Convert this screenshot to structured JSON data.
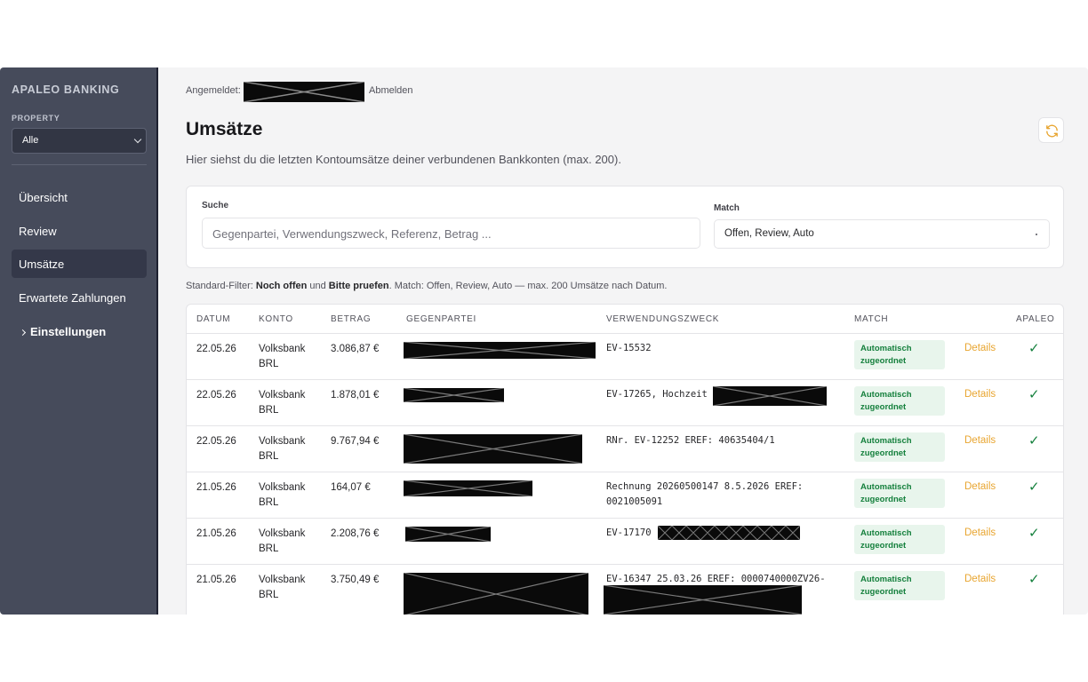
{
  "sidebar": {
    "brand": "APALEO BANKING",
    "property_label": "PROPERTY",
    "property_value": "Alle",
    "items": [
      {
        "label": "Übersicht"
      },
      {
        "label": "Review"
      },
      {
        "label": "Umsätze"
      },
      {
        "label": "Erwartete Zahlungen"
      },
      {
        "label": "Einstellungen"
      }
    ]
  },
  "header": {
    "logged_in_label": "Angemeldet:",
    "logout_label": "Abmelden",
    "title": "Umsätze",
    "subtitle": "Hier siehst du die letzten Kontoumsätze deiner verbundenen Bankkonten (max. 200)."
  },
  "filters": {
    "search_label": "Suche",
    "search_placeholder": "Gegenpartei, Verwendungszweck, Referenz, Betrag ...",
    "match_label": "Match",
    "match_value": "Offen, Review, Auto"
  },
  "standard_filter": {
    "prefix": "Standard-Filter: ",
    "open": "Noch offen",
    "and": " und ",
    "review": "Bitte pruefen",
    "suffix": ". Match: Offen, Review, Auto — max. 200 Umsätze nach Datum."
  },
  "table": {
    "headers": [
      "DATUM",
      "KONTO",
      "BETRAG",
      "GEGENPARTEI",
      "VERWENDUNGSZWECK",
      "MATCH",
      "APALEO"
    ],
    "rows": [
      {
        "datum": "22.05.26",
        "konto": "Volksbank BRL",
        "betrag": "3.086,87 €",
        "zweck": "EV-15532",
        "match": "Automatisch zugeordnet",
        "action": "Details",
        "apaleo": "✓"
      },
      {
        "datum": "22.05.26",
        "konto": "Volksbank BRL",
        "betrag": "1.878,01 €",
        "zweck": "EV-17265, Hochzeit",
        "match": "Automatisch zugeordnet",
        "action": "Details",
        "apaleo": "✓"
      },
      {
        "datum": "22.05.26",
        "konto": "Volksbank BRL",
        "betrag": "9.767,94 €",
        "zweck": "RNr. EV-12252 EREF: 40635404/1",
        "match": "Automatisch zugeordnet",
        "action": "Details",
        "apaleo": "✓"
      },
      {
        "datum": "21.05.26",
        "konto": "Volksbank BRL",
        "betrag": "164,07 €",
        "zweck": "Rechnung 20260500147 8.5.2026 EREF: 0021005091",
        "match": "Automatisch zugeordnet",
        "action": "Details",
        "apaleo": "✓"
      },
      {
        "datum": "21.05.26",
        "konto": "Volksbank BRL",
        "betrag": "2.208,76 €",
        "zweck": "EV-17170",
        "match": "Automatisch zugeordnet",
        "action": "Details",
        "apaleo": "✓"
      },
      {
        "datum": "21.05.26",
        "konto": "Volksbank BRL",
        "betrag": "3.750,49 €",
        "zweck": "EV-16347 25.03.26 EREF: 0000740000ZV26-",
        "match": "Automatisch zugeordnet",
        "action": "Details",
        "apaleo": "✓"
      }
    ]
  }
}
